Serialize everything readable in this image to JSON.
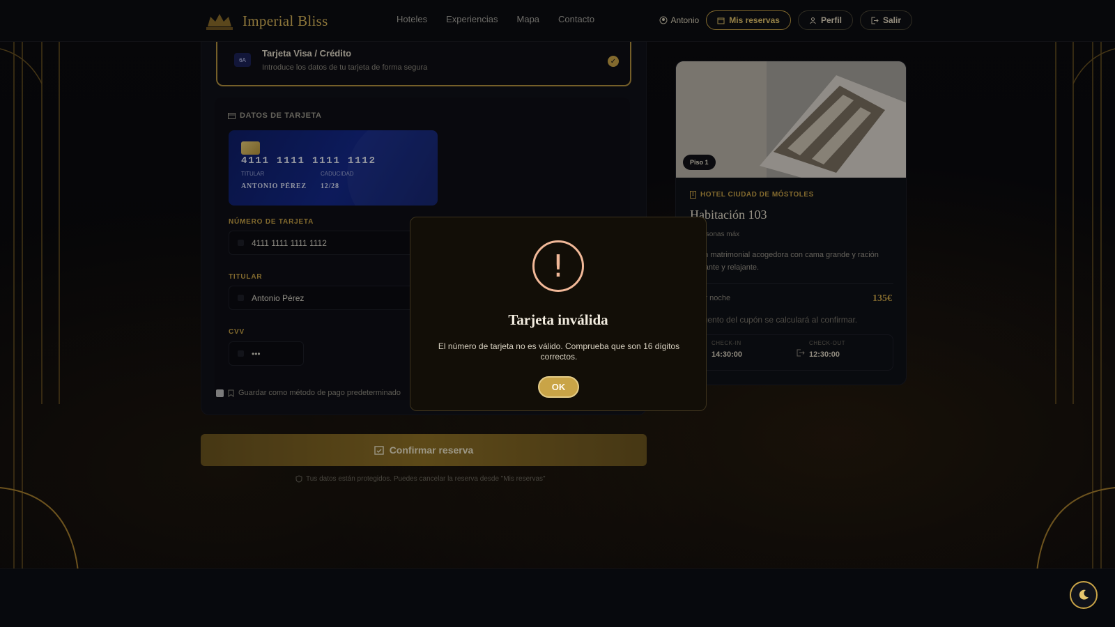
{
  "header": {
    "brand": "Imperial Bliss",
    "nav": [
      "Hoteles",
      "Experiencias",
      "Mapa",
      "Contacto"
    ],
    "user": "Antonio",
    "buttons": {
      "reservations": "Mis reservas",
      "profile": "Perfil",
      "logout": "Salir"
    }
  },
  "payment_method": {
    "title": "Tarjeta Visa / Crédito",
    "subtitle": "Introduce los datos de tu tarjeta de forma segura",
    "badge": "6A"
  },
  "card_section": {
    "title": "DATOS DE TARJETA",
    "preview": {
      "number": "4111 1111 1111 1112",
      "holder_label": "TITULAR",
      "holder": "ANTONIO PÉREZ",
      "expiry_label": "CADUCIDAD",
      "expiry": "12/28"
    },
    "fields": {
      "number_label": "NÚMERO DE TARJETA",
      "number_value": "4111 1111 1111 1112",
      "holder_label": "TITULAR",
      "holder_value": "Antonio Pérez",
      "cvv_label": "CVV",
      "cvv_value": "•••"
    },
    "save_default": "Guardar como método de pago predeterminado"
  },
  "confirm_button": "Confirmar reserva",
  "secure_note": "Tus datos están protegidos. Puedes cancelar la reserva desde \"Mis reservas\"",
  "room": {
    "floor": "Piso 1",
    "hotel": "HOTEL CIUDAD DE MÓSTOLES",
    "title": "Habitación 103",
    "capacity": "2 personas máx",
    "description": "ación matrimonial acogedora con cama grande y ración elegante y relajante.",
    "price_label": "o por noche",
    "price": "135€",
    "coupon_note": "escuento del cupón se calculará al confirmar.",
    "checkin_label": "CHECK-IN",
    "checkin": "14:30:00",
    "checkout_label": "CHECK-OUT",
    "checkout": "12:30:00"
  },
  "modal": {
    "icon": "!",
    "title": "Tarjeta inválida",
    "message": "El número de tarjeta no es válido. Comprueba que son 16 dígitos correctos.",
    "ok": "OK"
  },
  "colors": {
    "accent": "#c9a447",
    "background": "#07070a",
    "warning": "#f1b898"
  }
}
